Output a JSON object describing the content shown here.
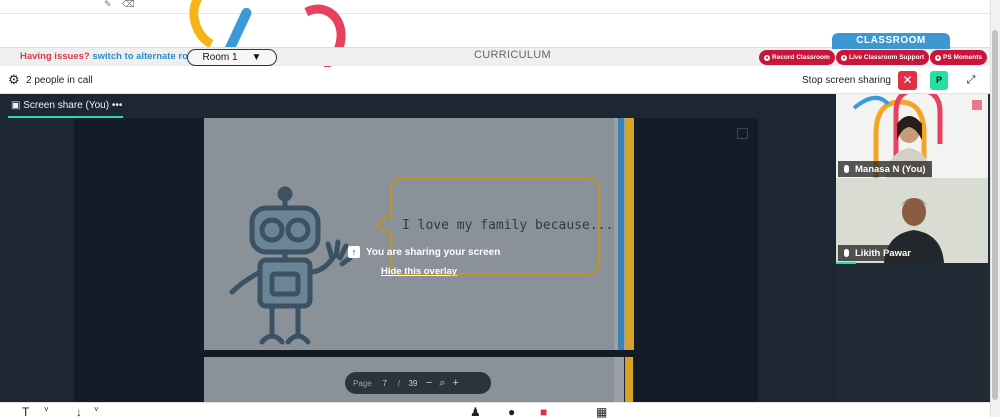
{
  "header": {
    "issues_text": "Having issues?",
    "alternate_link": "switch to alternate room",
    "room_label": "Room 1",
    "room_caret": "▼",
    "curriculum_label": "CURRICULUM",
    "classroom_tab": "CLASSROOM",
    "pills": [
      {
        "label": "Record Classroom"
      },
      {
        "label": "Live Classroom Support"
      },
      {
        "label": "PS Moments"
      }
    ]
  },
  "callbar": {
    "people_count": "2 people in call",
    "stop_sharing": "Stop screen sharing",
    "p_button": "P"
  },
  "stage": {
    "tab_label": "Screen share (You)",
    "tab_more": "•••",
    "slide_text": "I love my family because...",
    "overlay_message": "You are sharing your screen",
    "hide_overlay": "Hide this overlay",
    "pager": {
      "page_label": "Page",
      "current_page": "7",
      "separator": "/",
      "total_pages": "39"
    }
  },
  "participants": [
    {
      "name": "Manasa N (You)"
    },
    {
      "name": "Likith Pawar"
    }
  ],
  "colors": {
    "accent_teal": "#2fd5b4",
    "danger": "#e42e45",
    "classroom_blue": "#3d97d3",
    "pill_red": "#c8163a"
  }
}
